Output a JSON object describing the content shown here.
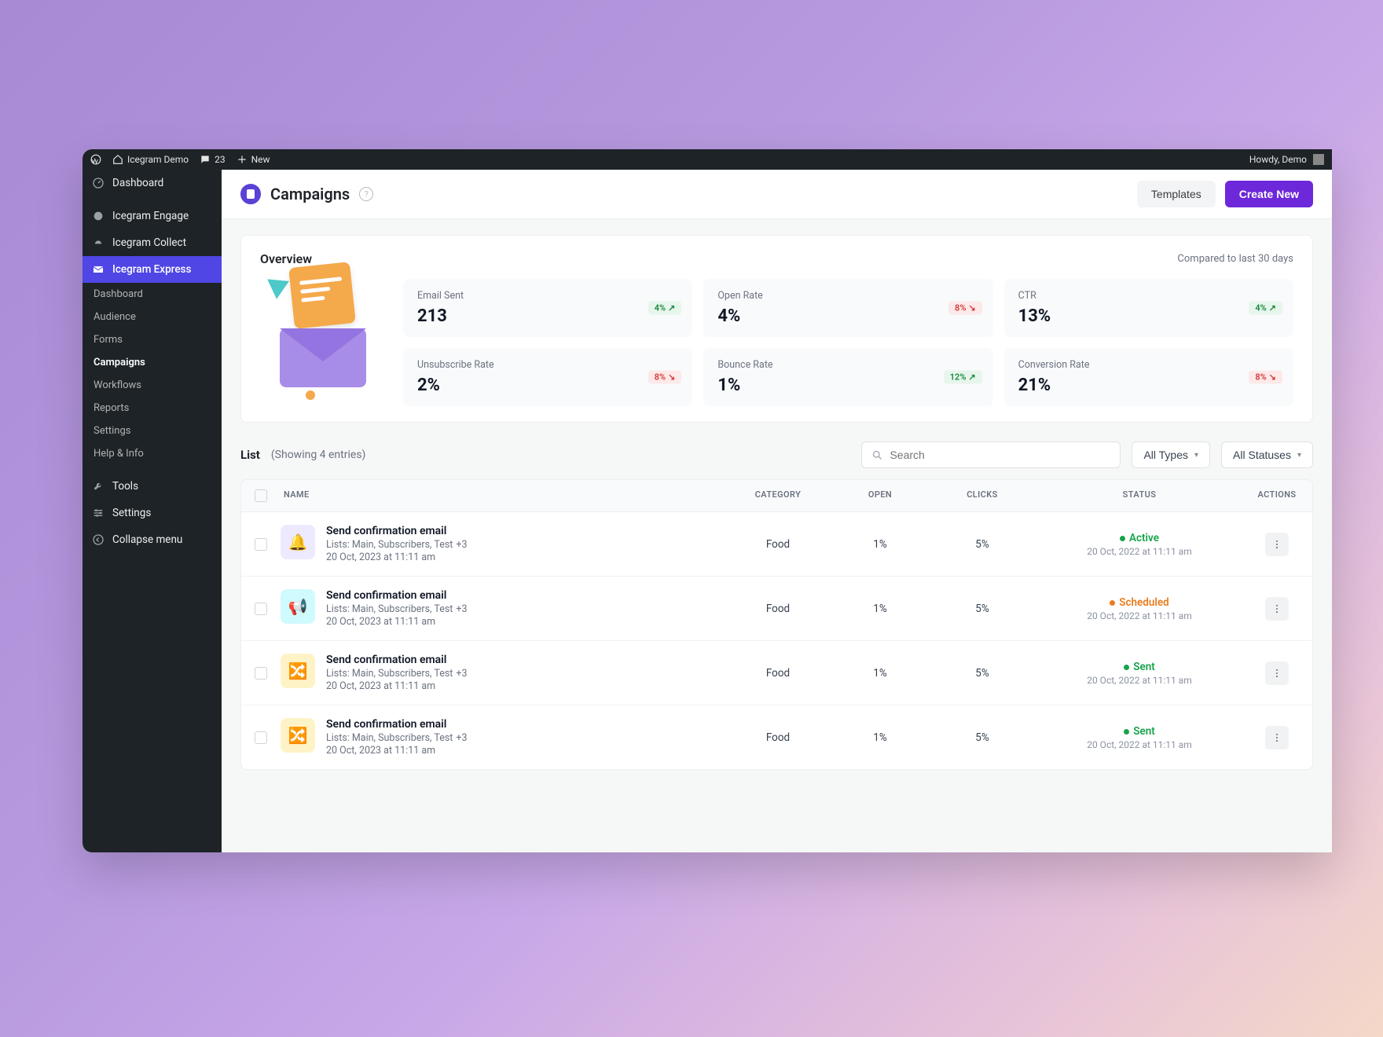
{
  "admin_bar": {
    "site_name": "Icegram Demo",
    "comments": "23",
    "new": "New",
    "howdy": "Howdy, Demo"
  },
  "sidebar": {
    "dashboard": "Dashboard",
    "engage": "Icegram Engage",
    "collect": "Icegram Collect",
    "express": "Icegram Express",
    "sub": {
      "dashboard": "Dashboard",
      "audience": "Audience",
      "forms": "Forms",
      "campaigns": "Campaigns",
      "workflows": "Workflows",
      "reports": "Reports",
      "settings": "Settings",
      "help": "Help & Info"
    },
    "tools": "Tools",
    "settings": "Settings",
    "collapse": "Collapse menu"
  },
  "header": {
    "title": "Campaigns",
    "templates": "Templates",
    "create": "Create New"
  },
  "overview": {
    "title": "Overview",
    "compared": "Compared to last 30 days",
    "stats": {
      "email_sent": {
        "label": "Email Sent",
        "value": "213",
        "badge": "4%",
        "dir": "up"
      },
      "open_rate": {
        "label": "Open Rate",
        "value": "4%",
        "badge": "8%",
        "dir": "down"
      },
      "ctr": {
        "label": "CTR",
        "value": "13%",
        "badge": "4%",
        "dir": "up"
      },
      "unsub": {
        "label": "Unsubscribe Rate",
        "value": "2%",
        "badge": "8%",
        "dir": "down"
      },
      "bounce": {
        "label": "Bounce Rate",
        "value": "1%",
        "badge": "12%",
        "dir": "up"
      },
      "conversion": {
        "label": "Conversion Rate",
        "value": "21%",
        "badge": "8%",
        "dir": "down"
      }
    }
  },
  "list": {
    "title": "List",
    "meta": "(Showing 4 entries)",
    "search_placeholder": "Search",
    "filter_types": "All Types",
    "filter_statuses": "All Statuses",
    "columns": {
      "name": "NAME",
      "category": "CATEGORY",
      "open": "OPEN",
      "clicks": "CLICKS",
      "status": "STATUS",
      "actions": "ACTIONS"
    },
    "rows": [
      {
        "thumb": "purple",
        "emoji": "🔔",
        "title": "Send confirmation email",
        "lists": "Lists: Main, Subscribers, Test",
        "extra": "+3",
        "date": "20 Oct, 2023 at 11:11 am",
        "category": "Food",
        "open": "1%",
        "clicks": "5%",
        "status": "Active",
        "status_class": "active",
        "status_date": "20 Oct, 2022 at 11:11 am"
      },
      {
        "thumb": "cyan",
        "emoji": "📢",
        "title": "Send confirmation email",
        "lists": "Lists: Main, Subscribers, Test",
        "extra": "+3",
        "date": "20 Oct, 2023 at 11:11 am",
        "category": "Food",
        "open": "1%",
        "clicks": "5%",
        "status": "Scheduled",
        "status_class": "scheduled",
        "status_date": "20 Oct, 2022 at 11:11 am"
      },
      {
        "thumb": "yellow",
        "emoji": "🔀",
        "title": "Send confirmation email",
        "lists": "Lists: Main, Subscribers, Test",
        "extra": "+3",
        "date": "20 Oct, 2023 at 11:11 am",
        "category": "Food",
        "open": "1%",
        "clicks": "5%",
        "status": "Sent",
        "status_class": "sent",
        "status_date": "20 Oct, 2022 at 11:11 am"
      },
      {
        "thumb": "yellow",
        "emoji": "🔀",
        "title": "Send confirmation email",
        "lists": "Lists: Main, Subscribers, Test",
        "extra": "+3",
        "date": "20 Oct, 2023 at 11:11 am",
        "category": "Food",
        "open": "1%",
        "clicks": "5%",
        "status": "Sent",
        "status_class": "sent",
        "status_date": "20 Oct, 2022 at 11:11 am"
      }
    ]
  }
}
